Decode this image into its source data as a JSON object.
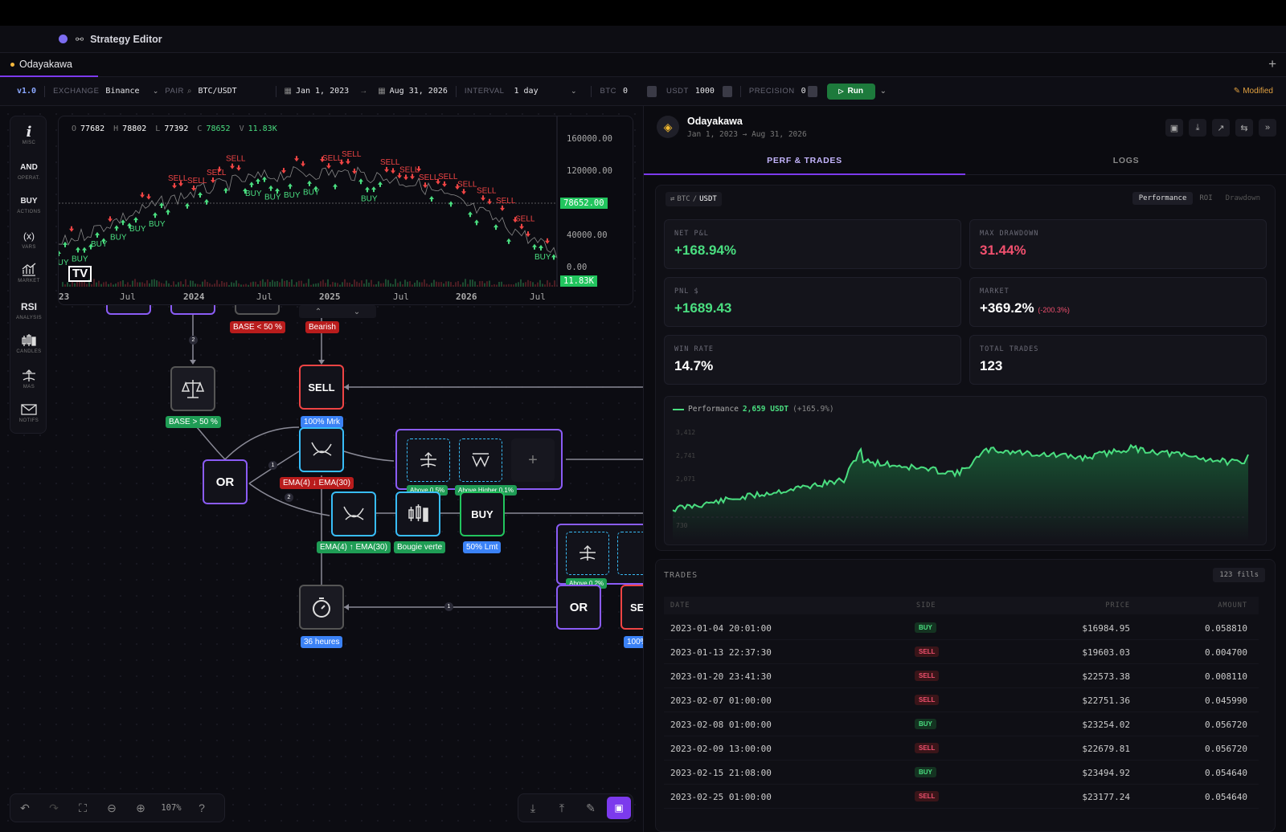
{
  "app": {
    "title": "Strategy Editor"
  },
  "tab": {
    "name": "Odayakawa"
  },
  "toolbar": {
    "version": "v1.0",
    "exchange_label": "EXCHANGE",
    "exchange": "Binance",
    "pair_label": "PAIR",
    "pair": "BTC/USDT",
    "start_date": "Jan 1, 2023",
    "end_date": "Aug 31, 2026",
    "interval_label": "INTERVAL",
    "interval": "1 day",
    "btc_label": "BTC",
    "btc": "0",
    "usdt_label": "USDT",
    "usdt": "1000",
    "precision_label": "PRECISION",
    "precision": "0",
    "run_label": "Run",
    "modified_label": "Modified"
  },
  "sidebar": {
    "items": [
      {
        "icon": "i",
        "caption": "MISC"
      },
      {
        "icon": "AND",
        "caption": "OPERAT."
      },
      {
        "icon": "BUY",
        "caption": "ACTIONS"
      },
      {
        "icon": "(x)",
        "caption": "VARS"
      },
      {
        "icon": "market-icon",
        "caption": "MARKET"
      },
      {
        "icon": "RSI",
        "caption": "ANALYSIS"
      },
      {
        "icon": "candles-icon",
        "caption": "CANDLES"
      },
      {
        "icon": "mas-icon",
        "caption": "MAS"
      },
      {
        "icon": "mail-icon",
        "caption": "NOTIFS"
      }
    ]
  },
  "price_chart": {
    "ohlcv": {
      "o_label": "O",
      "o": "77682",
      "h_label": "H",
      "h": "78802",
      "l_label": "L",
      "l": "77392",
      "c_label": "C",
      "c": "78652",
      "v_label": "V",
      "v": "11.83K"
    },
    "y_ticks": [
      "160000.00",
      "120000.00",
      "78652.00",
      "40000.00",
      "0.00",
      "11.83K"
    ],
    "x_ticks": [
      "23",
      "Jul",
      "2024",
      "Jul",
      "2025",
      "Jul",
      "2026",
      "Jul"
    ],
    "last_price": "78652.00",
    "last_volume": "11.83K",
    "signal_buy": "BUY",
    "signal_sell": "SELL",
    "logo_text": "TV"
  },
  "nodes": {
    "or1": "OR",
    "or2": "OR",
    "sell": "SELL",
    "buy": "BUY",
    "sell_partial": "SE",
    "plus": "+"
  },
  "tags": {
    "base_lt": "BASE < 50 %",
    "bearish": "Bearish",
    "mrk": "100% Mrk",
    "base_gt": "BASE > 50 %",
    "ema_down": "EMA(4) ↓ EMA(30)",
    "ema_up": "EMA(4) ↑ EMA(30)",
    "bougie": "Bougie verte",
    "lmt": "50% Lmt",
    "heures": "36 heures",
    "above1": "Above 0.5%",
    "above_higher": "Above Higher 0.1%",
    "above2": "Above 0.2%",
    "pct100": "100%",
    "edge_1a": "2",
    "edge_1b": "1",
    "edge_1c": "2",
    "edge_1d": "1"
  },
  "zoom": "107%",
  "right": {
    "strategy_name": "Odayakawa",
    "date_range": "Jan 1, 2023 → Aug 31, 2026",
    "tabs": [
      "PERF & TRADES",
      "LOGS"
    ],
    "pair_chip_base": "BTC",
    "pair_chip_quote": "USDT",
    "view_tabs": [
      "Performance",
      "ROI",
      "Drawdown"
    ],
    "metrics": [
      {
        "label": "NET P&L",
        "value": "+168.94%",
        "color": "#4ade80"
      },
      {
        "label": "MAX DRAWDOWN",
        "value": "31.44%",
        "color": "#f0506e"
      },
      {
        "label": "PNL $",
        "value": "+1689.43",
        "color": "#4ade80"
      },
      {
        "label": "MARKET",
        "value": "+369.2%",
        "sub": "(-200.3%)",
        "color": "#ffffff"
      },
      {
        "label": "WIN RATE",
        "value": "14.7%",
        "color": "#ffffff"
      },
      {
        "label": "TOTAL TRADES",
        "value": "123",
        "color": "#ffffff"
      }
    ],
    "perf_chart": {
      "legend_label": "Performance",
      "legend_value": "2,659 USDT",
      "legend_change": "(+165.9%)",
      "y_ticks": [
        "3,412",
        "2,741",
        "2,071",
        "730"
      ]
    },
    "trades": {
      "title": "TRADES",
      "fills": "123 fills",
      "columns": [
        "DATE",
        "SIDE",
        "PRICE",
        "AMOUNT"
      ],
      "rows": [
        {
          "date": "2023-01-04 20:01:00",
          "side": "BUY",
          "price": "$16984.95",
          "amount": "0.058810"
        },
        {
          "date": "2023-01-13 22:37:30",
          "side": "SELL",
          "price": "$19603.03",
          "amount": "0.004700"
        },
        {
          "date": "2023-01-20 23:41:30",
          "side": "SELL",
          "price": "$22573.38",
          "amount": "0.008110"
        },
        {
          "date": "2023-02-07 01:00:00",
          "side": "SELL",
          "price": "$22751.36",
          "amount": "0.045990"
        },
        {
          "date": "2023-02-08 01:00:00",
          "side": "BUY",
          "price": "$23254.02",
          "amount": "0.056720"
        },
        {
          "date": "2023-02-09 13:00:00",
          "side": "SELL",
          "price": "$22679.81",
          "amount": "0.056720"
        },
        {
          "date": "2023-02-15 21:08:00",
          "side": "BUY",
          "price": "$23494.92",
          "amount": "0.054640"
        },
        {
          "date": "2023-02-25 01:00:00",
          "side": "SELL",
          "price": "$23177.24",
          "amount": "0.054640"
        }
      ]
    }
  },
  "colors": {
    "accent": "#7c3aed",
    "buy": "#4ade80",
    "sell": "#ef4444",
    "node_purple": "#8b5cf6",
    "node_cyan": "#38bdf8"
  }
}
